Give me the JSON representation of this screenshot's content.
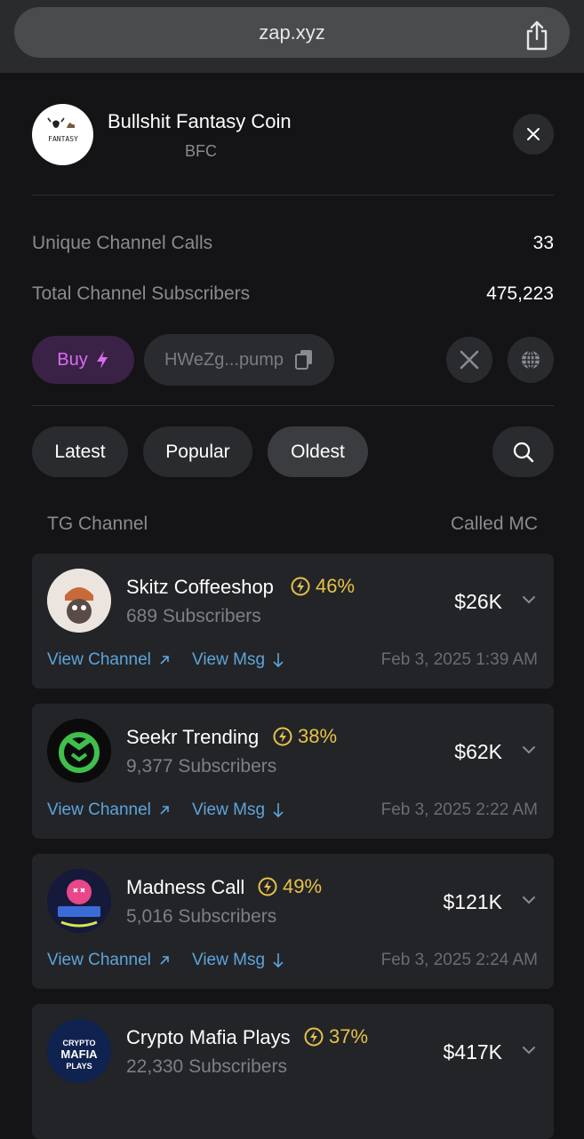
{
  "browser": {
    "url": "zap.xyz"
  },
  "coin": {
    "name": "Bullshit Fantasy Coin",
    "ticker": "BFC",
    "logo_text": "FANTASY"
  },
  "stats": [
    {
      "label": "Unique Channel Calls",
      "value": "33"
    },
    {
      "label": "Total Channel Subscribers",
      "value": "475,223"
    }
  ],
  "actions": {
    "buy_label": "Buy",
    "address": "HWeZg...pump"
  },
  "tabs": [
    "Latest",
    "Popular",
    "Oldest"
  ],
  "active_tab": "Oldest",
  "columns": {
    "left": "TG Channel",
    "right": "Called MC"
  },
  "link_labels": {
    "view_channel": "View Channel",
    "view_msg": "View Msg"
  },
  "channels": [
    {
      "name": "Skitz Coffeeshop",
      "percent": "46%",
      "subscribers": "689 Subscribers",
      "called_mc": "$26K",
      "date": "Feb 3, 2025 1:39 AM"
    },
    {
      "name": "Seekr Trending",
      "percent": "38%",
      "subscribers": "9,377 Subscribers",
      "called_mc": "$62K",
      "date": "Feb 3, 2025 2:22 AM"
    },
    {
      "name": "Madness Call",
      "percent": "49%",
      "subscribers": "5,016 Subscribers",
      "called_mc": "$121K",
      "date": "Feb 3, 2025 2:24 AM"
    },
    {
      "name": "Crypto Mafia Plays",
      "percent": "37%",
      "subscribers": "22,330 Subscribers",
      "called_mc": "$417K",
      "date": "",
      "avatar_text": [
        "CRYPTO",
        "MAFIA",
        "PLAYS"
      ]
    }
  ],
  "colors": {
    "accent_buy": "#d86ff0",
    "percent": "#e7c24a",
    "link": "#5da5dc"
  }
}
